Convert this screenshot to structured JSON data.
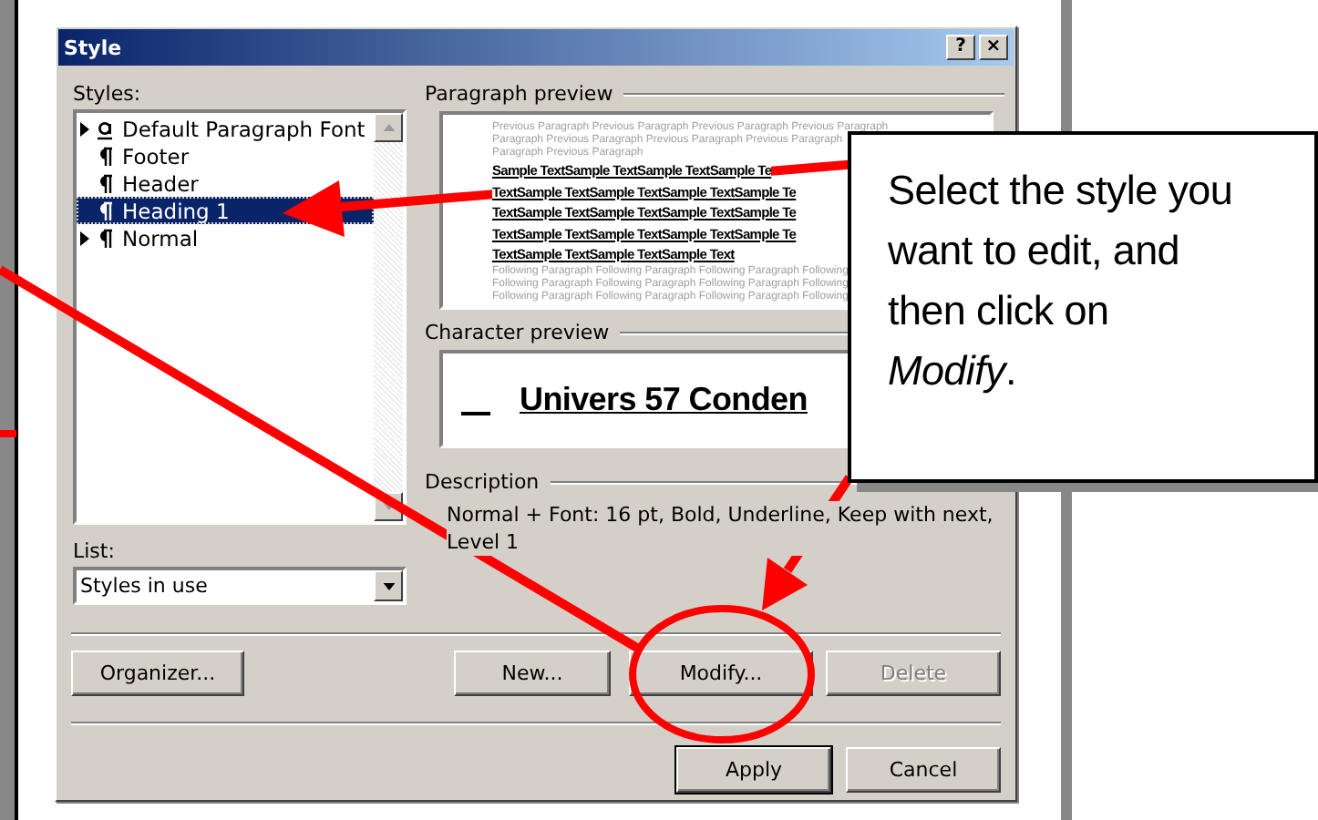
{
  "window": {
    "title": "Style",
    "title_buttons": [
      "?",
      "×"
    ]
  },
  "styles_list": {
    "label": "Styles:",
    "items": [
      {
        "name": "Default Paragraph Font",
        "kind": "character",
        "expandable": true,
        "selected": false
      },
      {
        "name": "Footer",
        "kind": "paragraph",
        "expandable": false,
        "selected": false
      },
      {
        "name": "Header",
        "kind": "paragraph",
        "expandable": false,
        "selected": false
      },
      {
        "name": "Heading 1",
        "kind": "paragraph",
        "expandable": false,
        "selected": true
      },
      {
        "name": "Normal",
        "kind": "paragraph",
        "expandable": true,
        "selected": false
      }
    ]
  },
  "list_filter": {
    "label": "List:",
    "value": "Styles in use"
  },
  "paragraph_preview": {
    "label": "Paragraph preview",
    "lines": [
      {
        "kind": "context",
        "text": "Previous Paragraph Previous Paragraph Previous Paragraph Previous Paragraph"
      },
      {
        "kind": "context",
        "text": "Paragraph Previous Paragraph Previous Paragraph Previous Paragraph"
      },
      {
        "kind": "context",
        "text": "Paragraph Previous Paragraph"
      },
      {
        "kind": "sample",
        "text": "Sample TextSample TextSample TextSample Te"
      },
      {
        "kind": "sample",
        "text": "TextSample TextSample TextSample TextSample Te"
      },
      {
        "kind": "sample",
        "text": "TextSample TextSample TextSample TextSample Te"
      },
      {
        "kind": "sample",
        "text": "TextSample TextSample TextSample TextSample Te"
      },
      {
        "kind": "sample",
        "text": "TextSample TextSample TextSample Text"
      },
      {
        "kind": "context",
        "text": "Following Paragraph Following Paragraph Following Paragraph Following"
      },
      {
        "kind": "context",
        "text": "Following Paragraph Following Paragraph Following Paragraph Following"
      },
      {
        "kind": "context",
        "text": "Following Paragraph Following Paragraph Following Paragraph Following"
      }
    ]
  },
  "character_preview": {
    "label": "Character preview",
    "text": "Univers 57 Conden"
  },
  "description": {
    "label": "Description",
    "text": "Normal + Font: 16 pt, Bold, Underline, Keep with next, Level 1"
  },
  "buttons": [
    {
      "label": "Organizer...",
      "disabled": false,
      "default": false
    },
    {
      "label": "New...",
      "disabled": false,
      "default": false
    },
    {
      "label": "Modify...",
      "disabled": false,
      "default": false
    },
    {
      "label": "Delete",
      "disabled": true,
      "default": false
    }
  ],
  "footer_buttons": [
    {
      "label": "Apply",
      "disabled": false,
      "default": true
    },
    {
      "label": "Cancel",
      "disabled": false,
      "default": false
    }
  ],
  "callout": {
    "text": "Select the style you want to edit, and then click on *Modify*."
  }
}
